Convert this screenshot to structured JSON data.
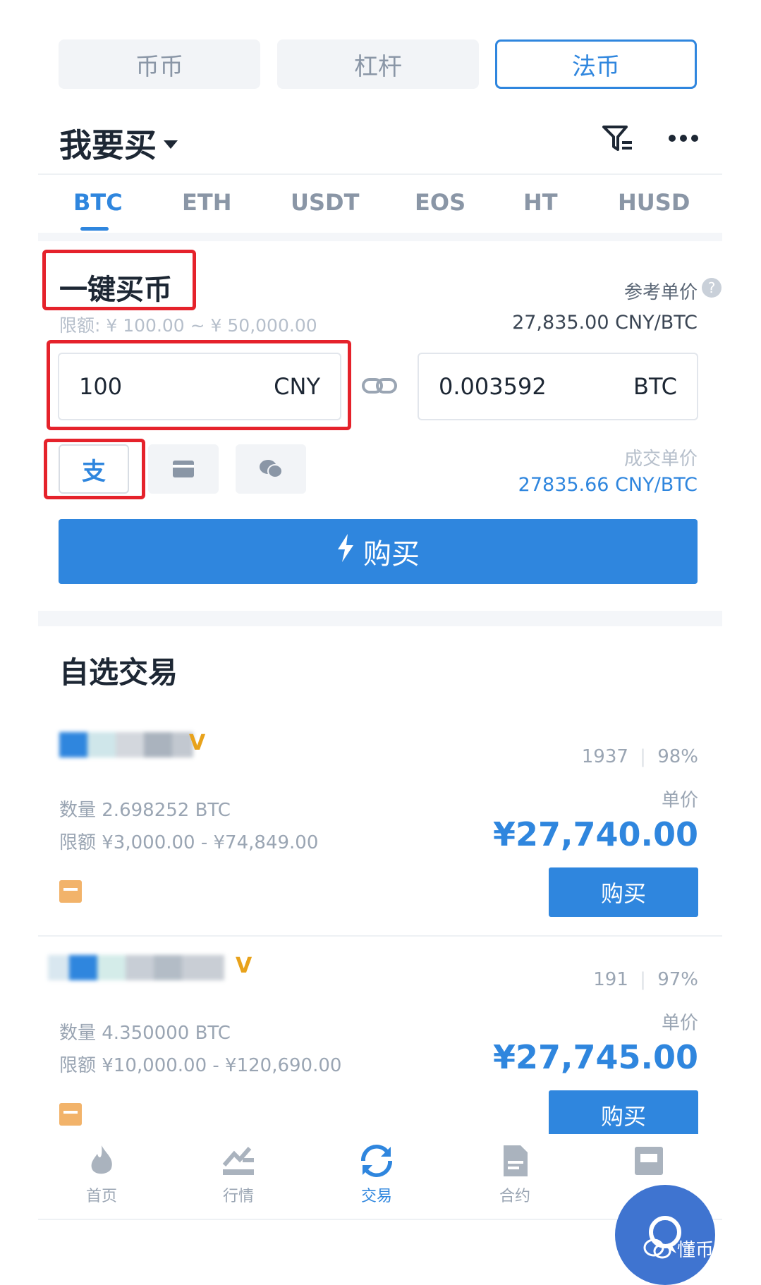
{
  "top_tabs": [
    {
      "label": "币币",
      "active": false
    },
    {
      "label": "杠杆",
      "active": false
    },
    {
      "label": "法币",
      "active": true
    }
  ],
  "header": {
    "title": "我要买"
  },
  "coin_tabs": [
    {
      "label": "BTC",
      "active": true
    },
    {
      "label": "ETH",
      "active": false
    },
    {
      "label": "USDT",
      "active": false
    },
    {
      "label": "EOS",
      "active": false
    },
    {
      "label": "HT",
      "active": false
    },
    {
      "label": "HUSD",
      "active": false
    }
  ],
  "quick_buy": {
    "title": "一键买币",
    "ref_price_label": "参考单价",
    "limit_text": "限额: ¥ 100.00 ~ ¥ 50,000.00",
    "ref_price_value": "27,835.00 CNY/BTC",
    "amount_value": "100",
    "amount_unit": "CNY",
    "crypto_value": "0.003592",
    "crypto_unit": "BTC",
    "deal_price_label": "成交单价",
    "deal_price_value": "27835.66 CNY/BTC",
    "buy_label": "购买"
  },
  "otc": {
    "title": "自选交易",
    "items": [
      {
        "stats_count": "1937",
        "stats_rate": "98%",
        "price_label": "单价",
        "quantity": "数量 2.698252 BTC",
        "limit": "限额 ¥3,000.00 - ¥74,849.00",
        "price": "¥27,740.00",
        "buy_label": "购买"
      },
      {
        "stats_count": "191",
        "stats_rate": "97%",
        "price_label": "单价",
        "quantity": "数量 4.350000 BTC",
        "limit": "限额 ¥10,000.00 - ¥120,690.00",
        "price": "¥27,745.00",
        "buy_label": "购买"
      }
    ]
  },
  "bottom_nav": [
    {
      "label": "首页",
      "icon": "flame-icon",
      "active": false
    },
    {
      "label": "行情",
      "icon": "chart-icon",
      "active": false
    },
    {
      "label": "交易",
      "icon": "refresh-icon",
      "active": true
    },
    {
      "label": "合约",
      "icon": "document-icon",
      "active": false
    },
    {
      "label": "",
      "icon": "assets-icon",
      "active": false
    }
  ],
  "watermark": "懂币哥",
  "colors": {
    "accent": "#2f86de",
    "highlight": "#e5222b",
    "badge": "#e8a21b"
  }
}
